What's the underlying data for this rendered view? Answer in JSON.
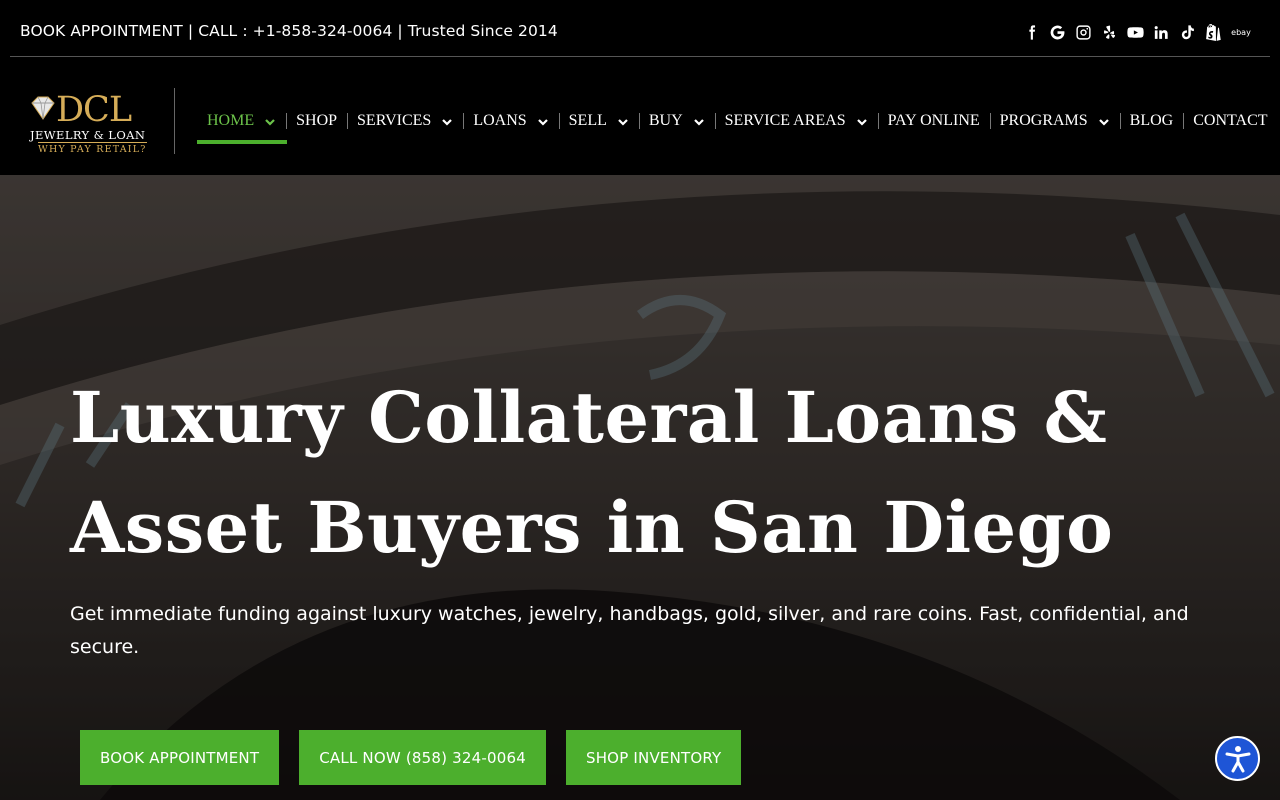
{
  "topbar": {
    "text": "BOOK APPOINTMENT | CALL : +1-858-324-0064 | Trusted Since 2014",
    "social_icons": [
      "facebook-icon",
      "google-icon",
      "instagram-icon",
      "yelp-icon",
      "youtube-icon",
      "linkedin-icon",
      "tiktok-icon",
      "shopify-icon",
      "ebay-icon"
    ],
    "ebay_label": "ebay"
  },
  "logo": {
    "main": "DCL",
    "sub": "JEWELRY & LOAN",
    "tagline": "WHY PAY RETAIL?",
    "gold": "#d6ad58"
  },
  "nav": {
    "items": [
      {
        "label": "HOME",
        "has_dropdown": true,
        "active": true
      },
      {
        "label": "SHOP",
        "has_dropdown": false
      },
      {
        "label": "SERVICES",
        "has_dropdown": true
      },
      {
        "label": "LOANS",
        "has_dropdown": true
      },
      {
        "label": "SELL",
        "has_dropdown": true
      },
      {
        "label": "BUY",
        "has_dropdown": true
      },
      {
        "label": "SERVICE AREAS",
        "has_dropdown": true
      },
      {
        "label": "PAY ONLINE",
        "has_dropdown": false
      },
      {
        "label": "PROGRAMS",
        "has_dropdown": true
      },
      {
        "label": "BLOG",
        "has_dropdown": false
      },
      {
        "label": "CONTACT",
        "has_dropdown": false
      }
    ],
    "active_color": "#6cc24a"
  },
  "hero": {
    "title_line1": "Luxury Collateral Loans &",
    "title_line2": "Asset Buyers in San Diego",
    "subtitle": "Get immediate funding against luxury watches, jewelry, handbags, gold, silver, and rare coins. Fast, confidential, and secure.",
    "buttons": {
      "book": "BOOK APPOINTMENT",
      "call": "CALL NOW (858) 324-0064",
      "shop": "SHOP INVENTORY"
    },
    "button_color": "#4caf2d"
  },
  "accessibility": {
    "icon": "accessibility-icon",
    "color": "#1e55d6"
  }
}
